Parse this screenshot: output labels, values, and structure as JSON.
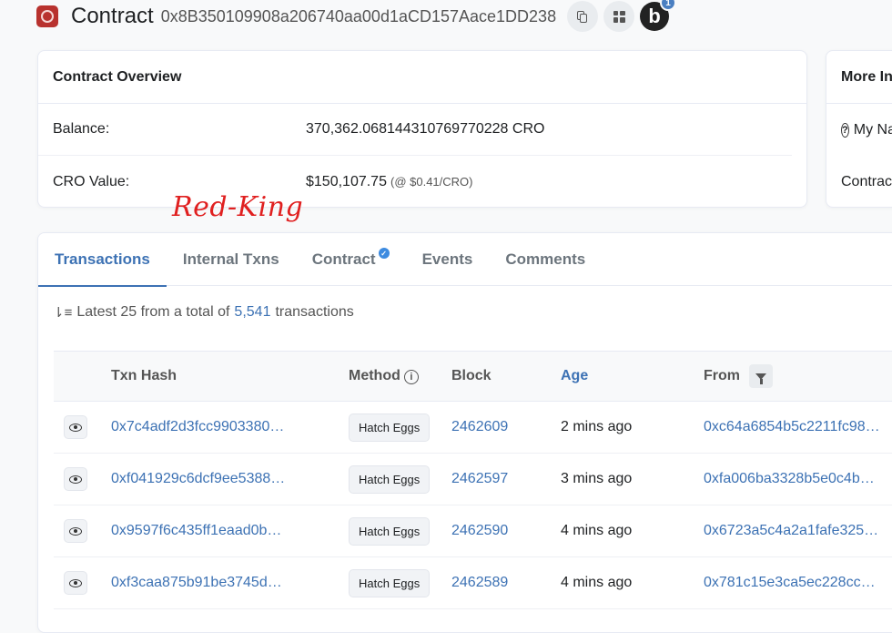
{
  "header": {
    "title": "Contract",
    "address": "0x8B350109908a206740aa00d1aCD157Aace1DD238",
    "profile_letter": "b",
    "notification_count": "1"
  },
  "overview": {
    "heading": "Contract Overview",
    "balance_label": "Balance:",
    "balance_value": "370,362.068144310769770228 CRO",
    "cro_value_label": "CRO Value:",
    "cro_value": "$150,107.75",
    "cro_rate": "(@ $0.41/CRO)"
  },
  "more_info": {
    "heading": "More Info",
    "my_name_tag": "My Name Tag:",
    "contract_creator": "Contract Creator:"
  },
  "overlay_text": "Red-King",
  "tabs": [
    "Transactions",
    "Internal Txns",
    "Contract",
    "Events",
    "Comments"
  ],
  "summary": {
    "prefix": "Latest 25 from a total of",
    "count": "5,541",
    "suffix": "transactions"
  },
  "table": {
    "headers": {
      "hash": "Txn Hash",
      "method": "Method",
      "block": "Block",
      "age": "Age",
      "from": "From"
    },
    "rows": [
      {
        "hash": "0x7c4adf2d3fcc9903380…",
        "method": "Hatch Eggs",
        "block": "2462609",
        "age": "2 mins ago",
        "from": "0xc64a6854b5c2211fc98…"
      },
      {
        "hash": "0xf041929c6dcf9ee5388…",
        "method": "Hatch Eggs",
        "block": "2462597",
        "age": "3 mins ago",
        "from": "0xfa006ba3328b5e0c4b…"
      },
      {
        "hash": "0x9597f6c435ff1eaad0b…",
        "method": "Hatch Eggs",
        "block": "2462590",
        "age": "4 mins ago",
        "from": "0x6723a5c4a2a1fafe325…"
      },
      {
        "hash": "0xf3caa875b91be3745d…",
        "method": "Hatch Eggs",
        "block": "2462589",
        "age": "4 mins ago",
        "from": "0x781c15e3ca5ec228cc…"
      }
    ]
  },
  "colors": {
    "link": "#3d72b4",
    "overlay": "#e02020"
  }
}
